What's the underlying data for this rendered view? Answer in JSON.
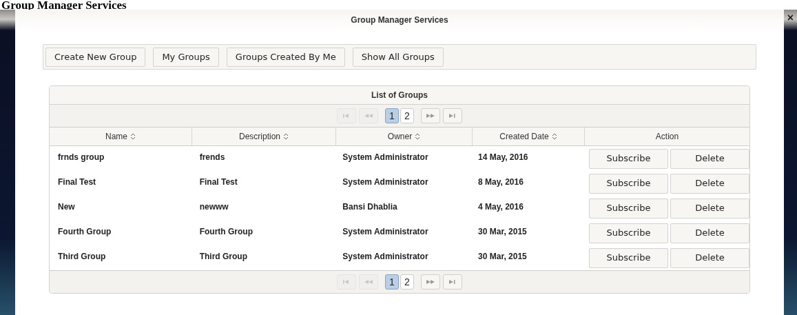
{
  "page_heading": "Group Manager Services",
  "dialog": {
    "title": "Group Manager Services",
    "close": "×"
  },
  "toolbar": [
    "Create New Group",
    "My Groups",
    "Groups Created By Me",
    "Show All Groups"
  ],
  "table": {
    "title": "List of Groups",
    "top_pager": {
      "pages": [
        {
          "label": "1",
          "selected": true
        },
        {
          "label": "2",
          "selected": false
        }
      ],
      "first_disabled": true,
      "prev_disabled": true,
      "next_disabled": false,
      "last_disabled": false
    },
    "columns": [
      {
        "label": "Name",
        "sortable": true
      },
      {
        "label": "Description",
        "sortable": true
      },
      {
        "label": "Owner",
        "sortable": true
      },
      {
        "label": "Created Date",
        "sortable": true
      },
      {
        "label": "Action",
        "sortable": false
      }
    ],
    "rows": [
      {
        "name": "frnds group",
        "description": "frends",
        "owner": "System Administrator",
        "created": "14 May, 2016",
        "actions": [
          "Subscribe",
          "Delete"
        ]
      },
      {
        "name": "Final Test",
        "description": "Final Test",
        "owner": "System Administrator",
        "created": "8 May, 2016",
        "actions": [
          "Subscribe",
          "Delete"
        ]
      },
      {
        "name": "New",
        "description": "newww",
        "owner": "Bansi Dhablia",
        "created": "4 May, 2016",
        "actions": [
          "Subscribe",
          "Delete"
        ]
      },
      {
        "name": "Fourth Group",
        "description": "Fourth Group",
        "owner": "System Administrator",
        "created": "30 Mar, 2015",
        "actions": [
          "Subscribe",
          "Delete"
        ]
      },
      {
        "name": "Third Group",
        "description": "Third Group",
        "owner": "System Administrator",
        "created": "30 Mar, 2015",
        "actions": [
          "Subscribe",
          "Delete"
        ]
      }
    ],
    "bottom_pager": {
      "pages": [
        {
          "label": "1",
          "selected": true
        },
        {
          "label": "2",
          "selected": false
        }
      ],
      "first_disabled": true,
      "prev_disabled": true,
      "next_disabled": false,
      "last_disabled": false
    }
  }
}
